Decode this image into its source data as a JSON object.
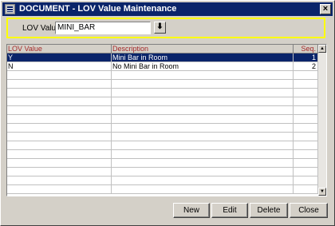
{
  "window": {
    "title": "DOCUMENT - LOV Value Maintenance",
    "close_glyph": "×"
  },
  "lov": {
    "label": "LOV Value",
    "value": "MINI_BAR",
    "down_glyph": "⬇"
  },
  "grid": {
    "headers": [
      "LOV Value",
      "Description",
      "Seq."
    ],
    "rows": [
      {
        "value": "Y",
        "description": "Mini Bar in Room",
        "seq": "1",
        "selected": true
      },
      {
        "value": "N",
        "description": "No Mini Bar in Room",
        "seq": "2",
        "selected": false
      }
    ],
    "empty_row_count": 14,
    "scroll_up_glyph": "▲",
    "scroll_down_glyph": "▼"
  },
  "buttons": {
    "new": "New",
    "edit": "Edit",
    "delete": "Delete",
    "close": "Close"
  },
  "colors": {
    "titlebar": "#0a246a",
    "selection": "#0a246a",
    "header_text": "#a52a2a",
    "lov_border": "#ffff00"
  }
}
